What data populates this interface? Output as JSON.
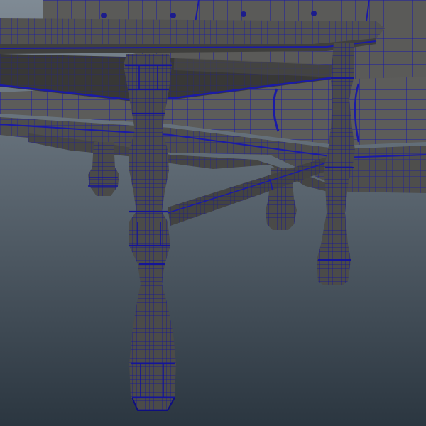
{
  "viewport": {
    "background_top": "#7f8a94",
    "background_bottom": "#2b3640"
  },
  "materials": {
    "wood": "#4a4a48",
    "wood_light": "#5e5e5b",
    "wood_dark": "#353533",
    "cushion": "#5a5a58",
    "wire": "#1a1aa8",
    "wire_dense": "#14149a"
  },
  "objects": [
    "sofa",
    "coffee-table"
  ]
}
